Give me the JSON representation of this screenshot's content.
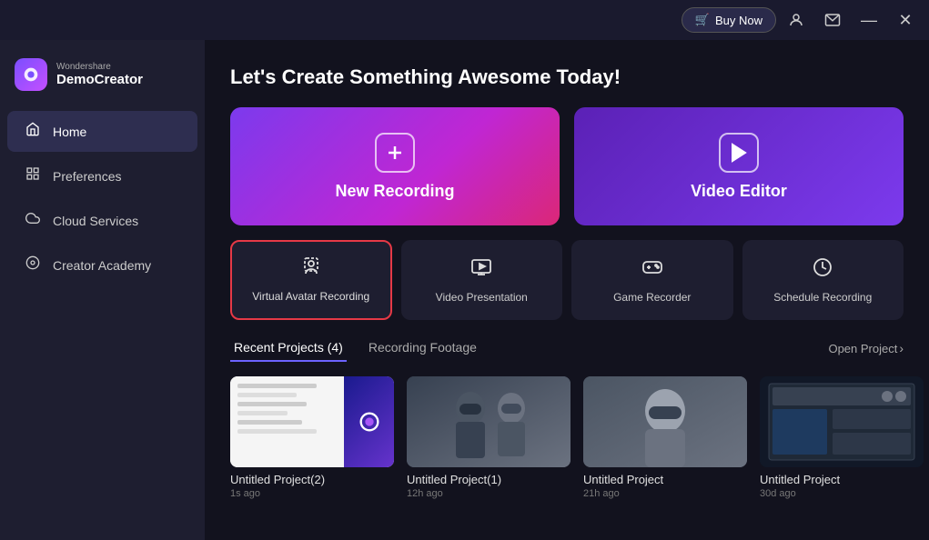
{
  "app": {
    "title": "Wondershare DemoCreator",
    "subtitle": "Wondershare",
    "logo_symbol": "W"
  },
  "titlebar": {
    "buy_now": "Buy Now",
    "cart_icon": "🛒",
    "minimize": "—",
    "close": "✕"
  },
  "sidebar": {
    "items": [
      {
        "id": "home",
        "label": "Home",
        "icon": "⌂",
        "active": true
      },
      {
        "id": "preferences",
        "label": "Preferences",
        "icon": "⊞"
      },
      {
        "id": "cloud-services",
        "label": "Cloud Services",
        "icon": "☁"
      },
      {
        "id": "creator-academy",
        "label": "Creator Academy",
        "icon": "◎"
      }
    ]
  },
  "main": {
    "page_title": "Let's Create Something Awesome Today!",
    "cards": {
      "new_recording": {
        "label": "New Recording",
        "icon": "+"
      },
      "video_editor": {
        "label": "Video Editor",
        "icon": "▶"
      }
    },
    "sub_cards": [
      {
        "id": "virtual-avatar",
        "label": "Virtual Avatar Recording",
        "icon": "👤",
        "active": true
      },
      {
        "id": "video-presentation",
        "label": "Video Presentation",
        "icon": "📊"
      },
      {
        "id": "game-recorder",
        "label": "Game Recorder",
        "icon": "🎮"
      },
      {
        "id": "schedule-recording",
        "label": "Schedule Recording",
        "icon": "⏰"
      }
    ],
    "tabs": [
      {
        "id": "recent-projects",
        "label": "Recent Projects (4)",
        "active": true
      },
      {
        "id": "recording-footage",
        "label": "Recording Footage",
        "active": false
      }
    ],
    "open_project": "Open Project",
    "projects": [
      {
        "id": 1,
        "name": "Untitled Project(2)",
        "time": "1s ago",
        "thumb_type": "document"
      },
      {
        "id": 2,
        "name": "Untitled Project(1)",
        "time": "12h ago",
        "thumb_type": "vr"
      },
      {
        "id": 3,
        "name": "Untitled Project",
        "time": "21h ago",
        "thumb_type": "vr2"
      },
      {
        "id": 4,
        "name": "Untitled Project",
        "time": "30d ago",
        "thumb_type": "screen"
      }
    ]
  }
}
